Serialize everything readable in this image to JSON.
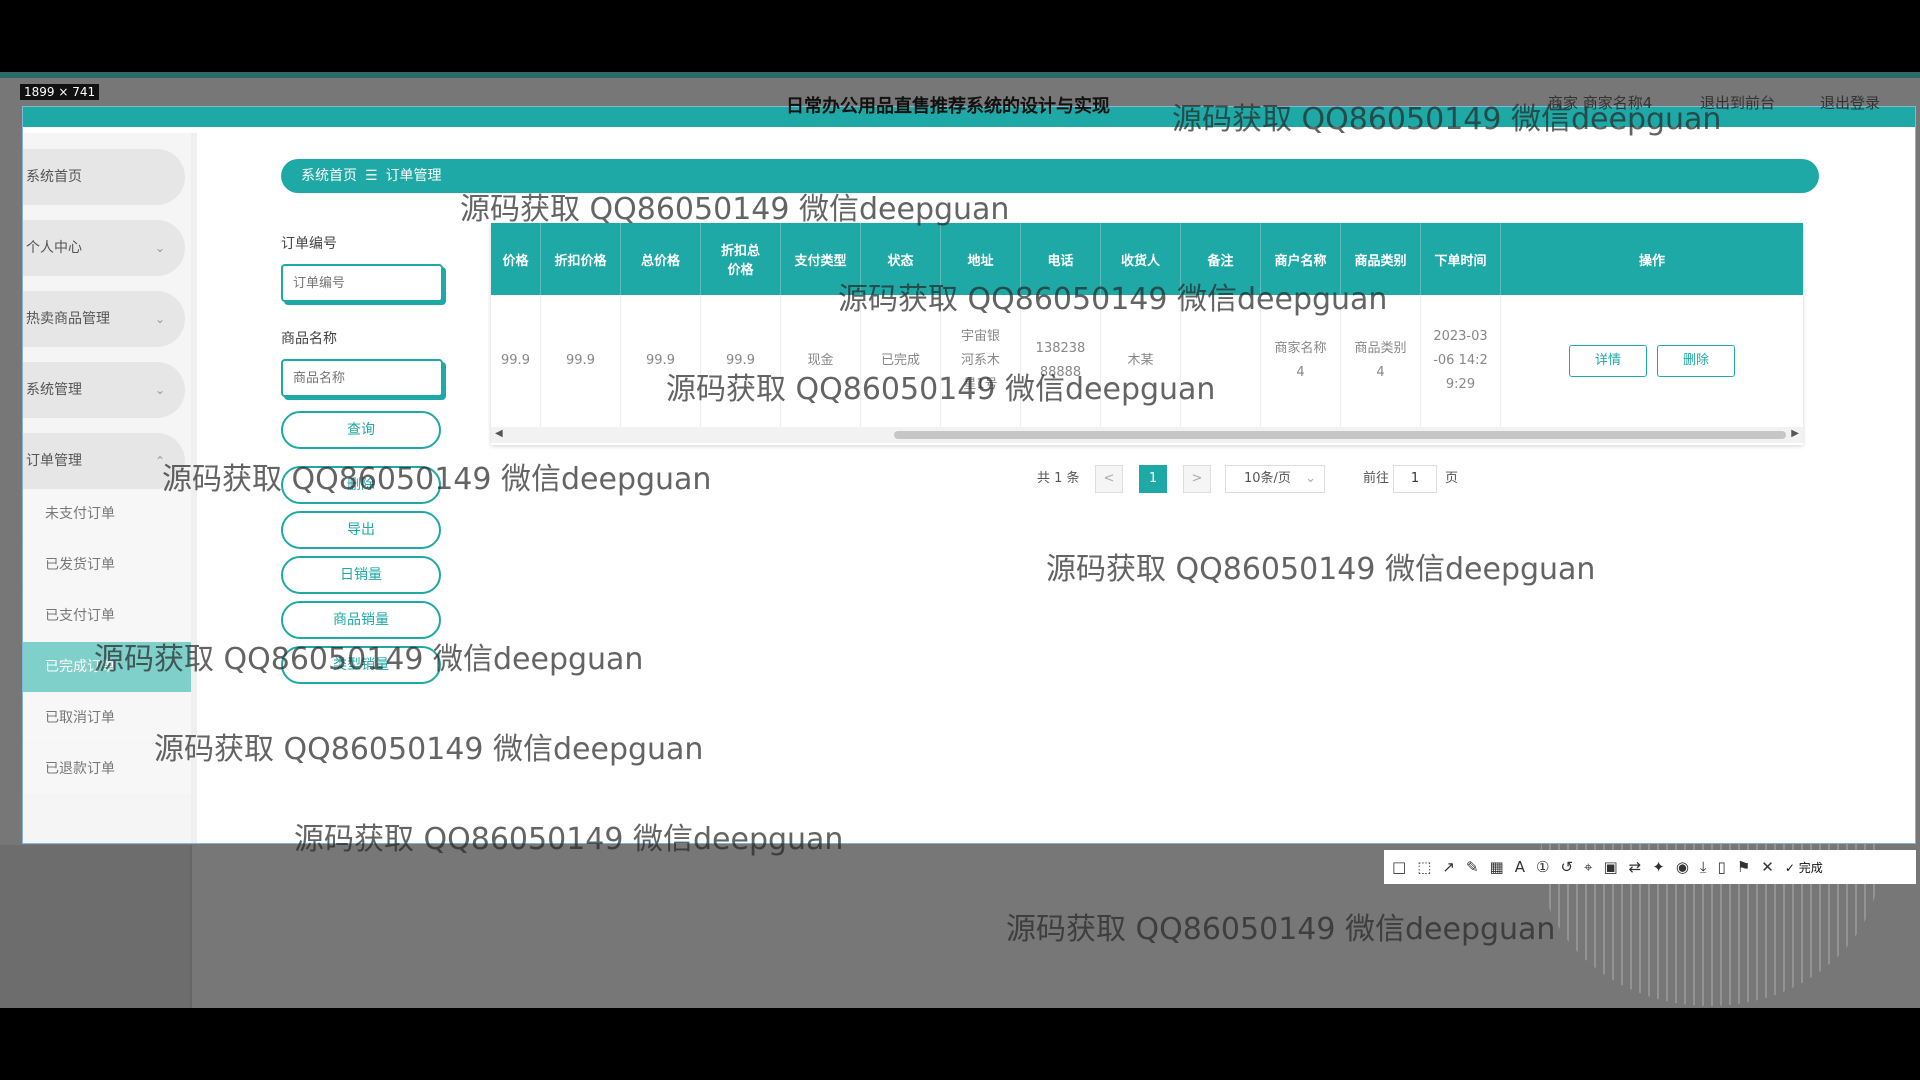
{
  "screenshot_tag": "1899 × 741",
  "app": {
    "title": "日常办公用品直售推荐系统的设计与实现",
    "user_label": "商家 商家名称4",
    "link_front": "退出到前台",
    "link_logout": "退出登录"
  },
  "sidebar": {
    "items": [
      {
        "label": "系统首页"
      },
      {
        "label": "个人中心"
      },
      {
        "label": "热卖商品管理"
      },
      {
        "label": "系统管理"
      },
      {
        "label": "订单管理"
      }
    ],
    "submenu": [
      {
        "label": "未支付订单"
      },
      {
        "label": "已发货订单"
      },
      {
        "label": "已支付订单"
      },
      {
        "label": "已完成订单"
      },
      {
        "label": "已取消订单"
      },
      {
        "label": "已退款订单"
      }
    ]
  },
  "breadcrumb": {
    "home": "系统首页",
    "separator": "☰",
    "current": "订单管理"
  },
  "search": {
    "order_no_label": "订单编号",
    "order_no_placeholder": "订单编号",
    "product_label": "商品名称",
    "product_placeholder": "商品名称",
    "query": "查询",
    "delete": "删除",
    "export": "导出",
    "daily_sales": "日销量",
    "product_sales": "商品销量",
    "category_sales": "类型销量"
  },
  "table": {
    "headers": [
      "价格",
      "折扣价格",
      "总价格",
      "折扣总价格",
      "支付类型",
      "状态",
      "地址",
      "电话",
      "收货人",
      "备注",
      "商户名称",
      "商品类别",
      "下单时间",
      "操作"
    ],
    "row": {
      "price": "99.9",
      "discount_price": "99.9",
      "total": "99.9",
      "discount_total": "99.9",
      "pay_type": "现金",
      "status": "已完成",
      "address": "宇宙银河系木星1号",
      "phone": "13823888888",
      "receiver": "木某",
      "remark": "",
      "merchant": "商家名称4",
      "category": "商品类别4",
      "order_time": "2023-03-06 14:29:29"
    },
    "op_detail": "详情",
    "op_delete": "删除"
  },
  "pagination": {
    "total": "共 1 条",
    "prev": "<",
    "current": "1",
    "next": ">",
    "page_size": "10条/页",
    "goto_label": "前往",
    "goto_value": "1",
    "page_suffix": "页"
  },
  "toolbar": {
    "icons": [
      "rectangle-icon",
      "select-icon",
      "arrow-icon",
      "pen-icon",
      "mosaic-icon",
      "text-icon",
      "number-icon",
      "undo-icon",
      "pin-icon",
      "ocr-icon",
      "translate-icon",
      "pin2-icon",
      "record-icon",
      "download-icon",
      "save-icon",
      "bookmark-icon"
    ],
    "cancel": "✕",
    "done": "✓ 完成"
  },
  "watermark": "源码获取 QQ86050149 微信deepguan"
}
